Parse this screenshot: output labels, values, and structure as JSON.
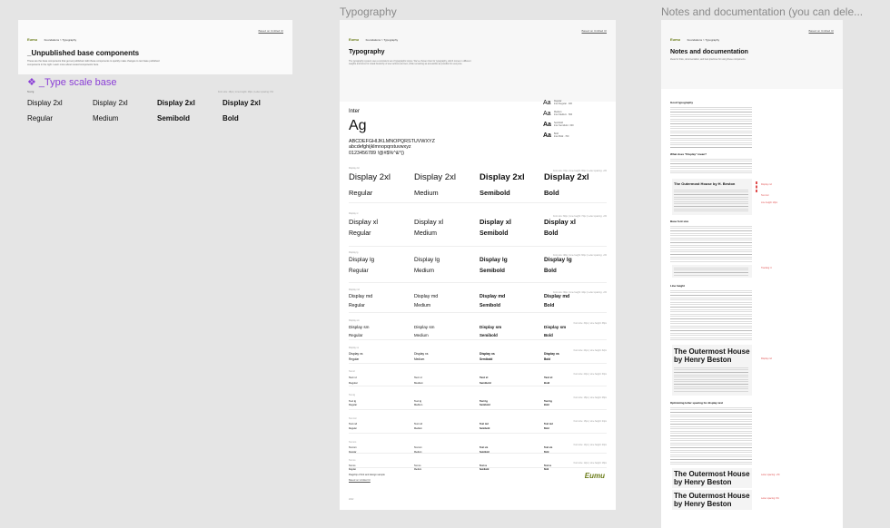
{
  "frames": {
    "middle_title": "Typography",
    "right_title": "Notes and documentation (you can dele..."
  },
  "brand": {
    "logo_text": "Eumu",
    "accent": "#8b3fd6",
    "logo_color": "#6b7c1a"
  },
  "left": {
    "breadcrumb": "Foundations > Typography",
    "top_link": "Based on Untitled UI",
    "title": "_Unpublished base components",
    "description": "These are the base components that get set published. Edit these components to quickly make changes to text base published components in the right. Learn more about nested components here.",
    "section": "❖ _Type scale base",
    "head_left": "Text lg",
    "head_right": "Font size: 18px | Line-height: 28px | Letter spacing: 0%",
    "row1": [
      "Display 2xl",
      "Display 2xl",
      "Display 2xl",
      "Display 2xl"
    ],
    "row2": [
      "Regular",
      "Medium",
      "Semibold",
      "Bold"
    ]
  },
  "middle": {
    "breadcrumb": "Foundations > Typography",
    "top_link": "Based on Untitled UI",
    "title": "Typography",
    "description": "The typography system uses a consistent set of typographic styles. We've chosen Inter for typography, which comes in different weights and sizes for visual hierarchy of user actions and text, while remaining as accessible as possible for everyone.",
    "font_name": "Inter",
    "ag": "Ag",
    "upper": "ABCDEFGHIJKLMNOPQRSTUVWXYZ",
    "lower": "abcdefghijklmnopqrstuvwxyz",
    "digits": "0123456789 !@#$%^&*()",
    "weights": [
      {
        "aa": "Aa",
        "name": "Regular",
        "meta": "Inter Regular · 400"
      },
      {
        "aa": "Aa",
        "name": "Medium",
        "meta": "Inter Medium · 500"
      },
      {
        "aa": "Aa",
        "name": "Semibold",
        "meta": "Inter Semibold · 600"
      },
      {
        "aa": "Aa",
        "name": "Bold",
        "meta": "Inter Bold · 700"
      }
    ],
    "scale": [
      {
        "label": "Display 2xl",
        "meta": "Font size: 72px | Line height: 90px | Letter spacing: -2%",
        "name": "Display 2xl"
      },
      {
        "label": "Display xl",
        "meta": "Font size: 60px | Line height: 72px | Letter spacing: -2%",
        "name": "Display xl"
      },
      {
        "label": "Display lg",
        "meta": "Font size: 48px | Line height: 60px | Letter spacing: -2%",
        "name": "Display lg"
      },
      {
        "label": "Display md",
        "meta": "Font size: 36px | Line height: 44px | Letter spacing: -2%",
        "name": "Display md"
      },
      {
        "label": "Display sm",
        "meta": "Font size: 30px | Line height: 38px",
        "name": "Display sm"
      },
      {
        "label": "Display xs",
        "meta": "Font size: 24px | Line height: 32px",
        "name": "Display xs"
      },
      {
        "label": "Text xl",
        "meta": "Font size: 20px | Line height: 30px",
        "name": "Text xl"
      },
      {
        "label": "Text lg",
        "meta": "Font size: 18px | Line height: 28px",
        "name": "Text lg"
      },
      {
        "label": "Text md",
        "meta": "Font size: 16px | Line height: 24px",
        "name": "Text md"
      },
      {
        "label": "Text sm",
        "meta": "Font size: 14px | Line height: 20px",
        "name": "Text sm"
      },
      {
        "label": "Text xs",
        "meta": "Font size: 12px | Line height: 18px",
        "name": "Text xs"
      }
    ],
    "weight_names": [
      "Regular",
      "Medium",
      "Semibold",
      "Bold"
    ],
    "footer1": "Flagship of link and design sample",
    "footer2": "Based on Untitled UI",
    "footer3": "2022",
    "footer_logo": "Eumu"
  },
  "right": {
    "breadcrumb": "Foundations > Typography",
    "top_link": "Based on Untitled UI",
    "title": "Notes and documentation",
    "subtitle": "Ideas for links, documentation, and best practices for using these components.",
    "h_good": "Good typography",
    "h_display": "What does \"Display\" mean?",
    "card1": "The Outermost House by H. Beston",
    "h_base": "Base font size",
    "h_line": "Line height",
    "card2": "The Outermost House by Henry Beston",
    "h_spacing": "Optimizing letter spacing for display text",
    "card3": "The Outermost House by Henry Beston",
    "card4": "The Outermost House by Henry Beston",
    "ann1": "Display md",
    "ann2": "Text md",
    "ann3": "Line height: 20px",
    "ann4": "Tracking: 0",
    "ann5": "Display md",
    "ann6": "Letter spacing: -2%",
    "ann7": "Letter spacing: 0%"
  }
}
